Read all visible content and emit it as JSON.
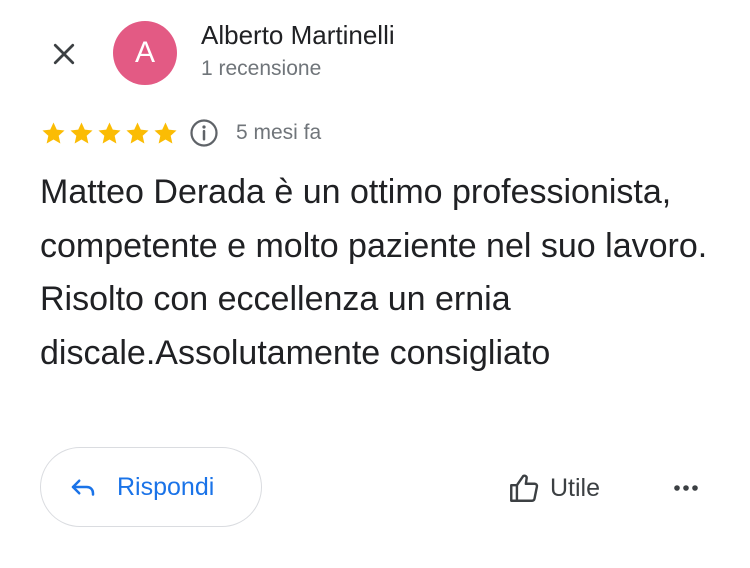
{
  "colors": {
    "avatar_bg": "#e35a84",
    "star": "#fbbc04",
    "link_blue": "#1a73e8",
    "secondary_text": "#70757a"
  },
  "header": {
    "close_icon": "close-icon",
    "avatar_letter": "A",
    "author_name": "Alberto Martinelli",
    "author_reviews": "1 recensione"
  },
  "rating": {
    "stars": 5,
    "max_stars": 5,
    "info_icon": "info-icon",
    "date": "5 mesi fa"
  },
  "review": {
    "text": "Matteo Derada è un ottimo professionista, competente e molto paziente nel suo lavoro. Risolto con eccellenza un ernia discale.Assolutamente consigliato"
  },
  "actions": {
    "reply_label": "Rispondi",
    "reply_icon": "reply-arrow-icon",
    "helpful_label": "Utile",
    "helpful_icon": "thumbs-up-icon",
    "more_icon": "more-horizontal-icon"
  }
}
